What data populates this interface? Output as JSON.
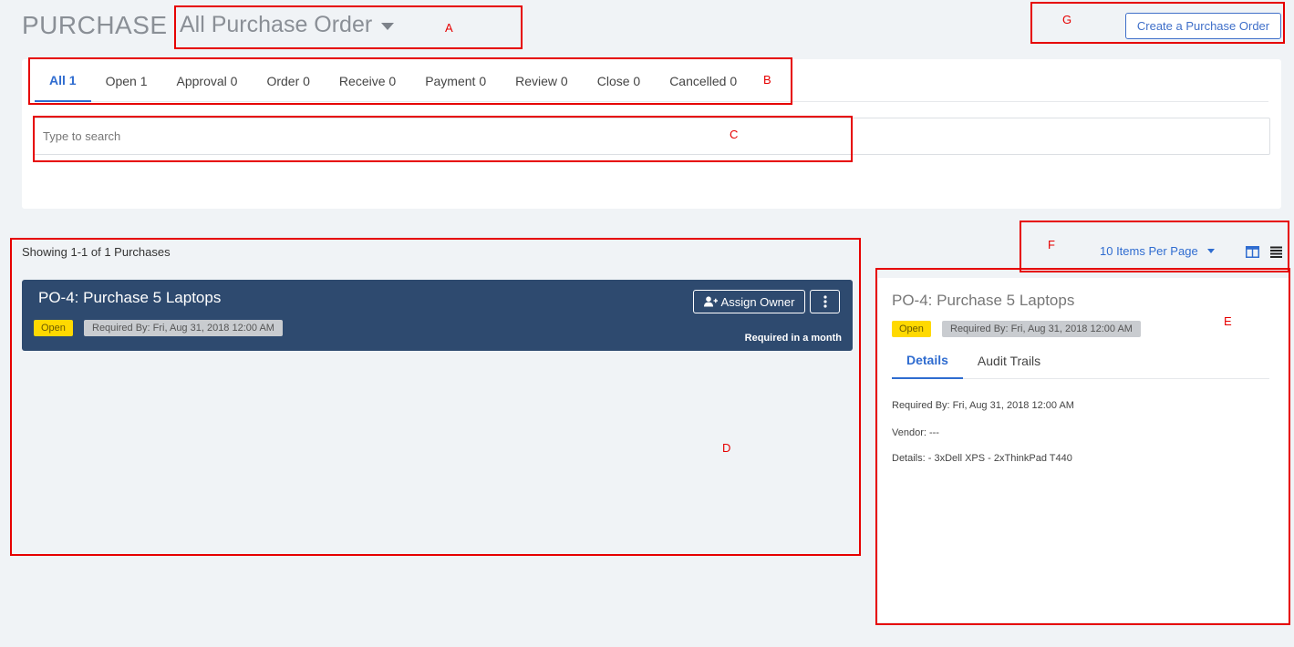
{
  "header": {
    "title": "PURCHASE",
    "view_label": "All Purchase Order",
    "create_label": "Create a Purchase Order"
  },
  "tabs": [
    {
      "label": "All 1"
    },
    {
      "label": "Open 1"
    },
    {
      "label": "Approval 0"
    },
    {
      "label": "Order 0"
    },
    {
      "label": "Receive 0"
    },
    {
      "label": "Payment 0"
    },
    {
      "label": "Review 0"
    },
    {
      "label": "Close 0"
    },
    {
      "label": "Cancelled 0"
    }
  ],
  "search": {
    "placeholder": "Type to search",
    "value": ""
  },
  "list": {
    "showing_text": "Showing 1-1 of 1 Purchases",
    "items": [
      {
        "title": "PO-4: Purchase 5 Laptops",
        "status": "Open",
        "required_by": "Required By: Fri, Aug 31, 2018 12:00 AM",
        "assign_label": "Assign Owner",
        "due_text": "Required in a month"
      }
    ]
  },
  "pagination": {
    "per_page_label": "10 Items Per Page"
  },
  "detail": {
    "title": "PO-4: Purchase 5 Laptops",
    "status": "Open",
    "required_by": "Required By: Fri, Aug 31, 2018 12:00 AM",
    "tabs": [
      "Details",
      "Audit Trails"
    ],
    "lines": [
      "Required By: Fri, Aug 31, 2018 12:00 AM",
      "Vendor: ---",
      "Details: - 3xDell XPS - 2xThinkPad T440"
    ]
  },
  "annotations": {
    "a": "A",
    "b": "B",
    "c": "C",
    "d": "D",
    "e": "E",
    "f": "F",
    "g": "G"
  },
  "colors": {
    "accent": "#2f6cd0",
    "card_bg": "#2e4a6f",
    "open_badge": "#ffd900",
    "annotation": "#e60000"
  },
  "icons": {
    "assign": "user-plus-icon",
    "more": "vertical-dots-icon",
    "view_split": "split-view-icon",
    "view_list": "list-view-icon"
  }
}
